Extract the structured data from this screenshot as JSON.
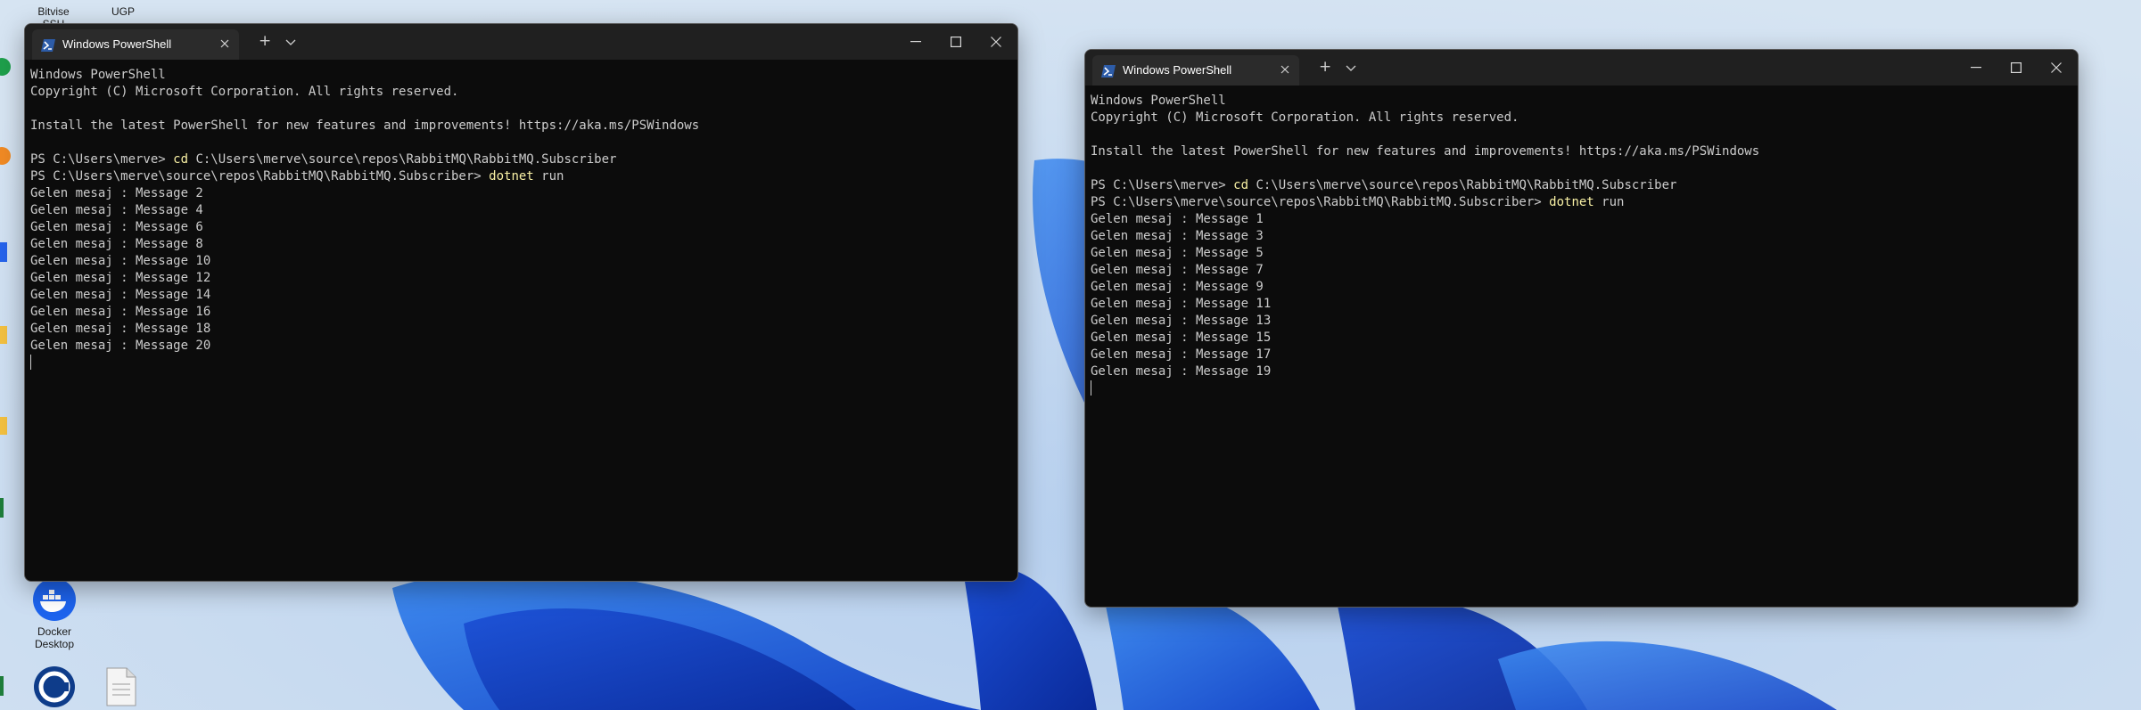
{
  "desktop": {
    "labels": {
      "bitvise": "Bitvise SSH",
      "ugp": "UGP",
      "docker": "Docker Desktop"
    }
  },
  "windows": [
    {
      "title": "Windows PowerShell",
      "new_tab_symbol": "+",
      "lines": [
        [
          {
            "t": "Windows PowerShell"
          }
        ],
        [
          {
            "t": "Copyright (C) Microsoft Corporation. All rights reserved."
          }
        ],
        [],
        [
          {
            "t": "Install the latest PowerShell for new features and improvements! https://aka.ms/PSWindows"
          }
        ],
        [],
        [
          {
            "t": "PS C:\\Users\\merve> "
          },
          {
            "t": "cd",
            "c": "yellow"
          },
          {
            "t": " C:\\Users\\merve\\source\\repos\\RabbitMQ\\RabbitMQ.Subscriber"
          }
        ],
        [
          {
            "t": "PS C:\\Users\\merve\\source\\repos\\RabbitMQ\\RabbitMQ.Subscriber> "
          },
          {
            "t": "dotnet",
            "c": "yellow"
          },
          {
            "t": " run"
          }
        ],
        [
          {
            "t": "Gelen mesaj : Message 2"
          }
        ],
        [
          {
            "t": "Gelen mesaj : Message 4"
          }
        ],
        [
          {
            "t": "Gelen mesaj : Message 6"
          }
        ],
        [
          {
            "t": "Gelen mesaj : Message 8"
          }
        ],
        [
          {
            "t": "Gelen mesaj : Message 10"
          }
        ],
        [
          {
            "t": "Gelen mesaj : Message 12"
          }
        ],
        [
          {
            "t": "Gelen mesaj : Message 14"
          }
        ],
        [
          {
            "t": "Gelen mesaj : Message 16"
          }
        ],
        [
          {
            "t": "Gelen mesaj : Message 18"
          }
        ],
        [
          {
            "t": "Gelen mesaj : Message 20"
          }
        ]
      ]
    },
    {
      "title": "Windows PowerShell",
      "new_tab_symbol": "+",
      "lines": [
        [
          {
            "t": "Windows PowerShell"
          }
        ],
        [
          {
            "t": "Copyright (C) Microsoft Corporation. All rights reserved."
          }
        ],
        [],
        [
          {
            "t": "Install the latest PowerShell for new features and improvements! https://aka.ms/PSWindows"
          }
        ],
        [],
        [
          {
            "t": "PS C:\\Users\\merve> "
          },
          {
            "t": "cd",
            "c": "yellow"
          },
          {
            "t": " C:\\Users\\merve\\source\\repos\\RabbitMQ\\RabbitMQ.Subscriber"
          }
        ],
        [
          {
            "t": "PS C:\\Users\\merve\\source\\repos\\RabbitMQ\\RabbitMQ.Subscriber> "
          },
          {
            "t": "dotnet",
            "c": "yellow"
          },
          {
            "t": " run"
          }
        ],
        [
          {
            "t": "Gelen mesaj : Message 1"
          }
        ],
        [
          {
            "t": "Gelen mesaj : Message 3"
          }
        ],
        [
          {
            "t": "Gelen mesaj : Message 5"
          }
        ],
        [
          {
            "t": "Gelen mesaj : Message 7"
          }
        ],
        [
          {
            "t": "Gelen mesaj : Message 9"
          }
        ],
        [
          {
            "t": "Gelen mesaj : Message 11"
          }
        ],
        [
          {
            "t": "Gelen mesaj : Message 13"
          }
        ],
        [
          {
            "t": "Gelen mesaj : Message 15"
          }
        ],
        [
          {
            "t": "Gelen mesaj : Message 17"
          }
        ],
        [
          {
            "t": "Gelen mesaj : Message 19"
          }
        ]
      ]
    }
  ],
  "colors": {
    "terminal_bg": "#0c0c0c",
    "terminal_text": "#cccccc",
    "command_highlight": "#f9f1a5",
    "titlebar": "#202020",
    "active_tab": "#2b2b2b",
    "powershell_blue": "#2d5ca8"
  }
}
